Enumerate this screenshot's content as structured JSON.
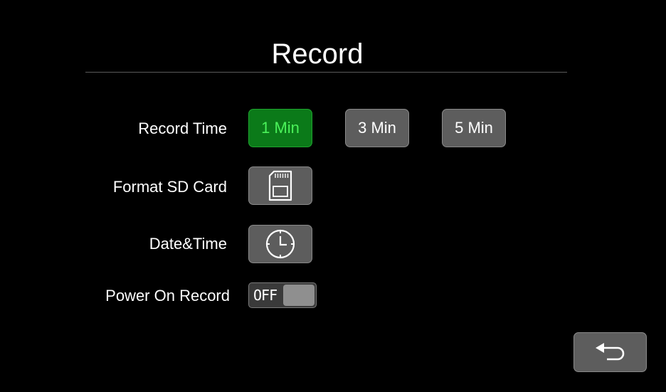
{
  "header": {
    "title": "Record"
  },
  "record_time": {
    "label": "Record Time",
    "options": [
      "1 Min",
      "3 Min",
      "5 Min"
    ],
    "selected": "1 Min"
  },
  "format_sd": {
    "label": "Format SD Card",
    "icon": "sd-card-icon"
  },
  "date_time": {
    "label": "Date&Time",
    "icon": "clock-icon"
  },
  "power_on_record": {
    "label": "Power On Record",
    "state": "OFF"
  },
  "back": {
    "icon": "back-arrow-icon"
  },
  "colors": {
    "background": "#000000",
    "button": "#5d5d5d",
    "selected_button": "#0b7a19",
    "selected_text": "#4bf25a"
  }
}
